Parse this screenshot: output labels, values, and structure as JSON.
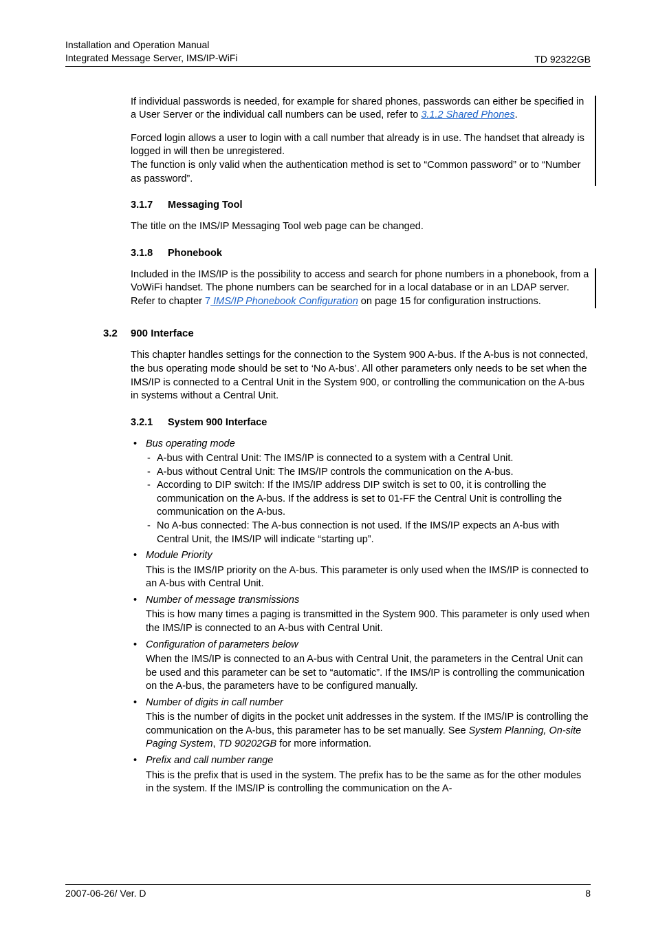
{
  "header": {
    "line1": "Installation and Operation Manual",
    "line2": "Integrated Message Server, IMS/IP-WiFi",
    "doc_id": "TD 92322GB"
  },
  "intro": {
    "p1_pre": "If individual passwords is needed, for example for shared phones, passwords can either be specified in a User Server or the individual call numbers can be used, refer to ",
    "p1_link": "3.1.2 Shared Phones",
    "p2a": "Forced login allows a user to login with a call number that already is in use. The handset that already is logged in will then be unregistered.",
    "p2b": "The function is only valid when the authentication method is set to “Common password” or to “Number as password”."
  },
  "s317": {
    "num": "3.1.7",
    "title": "Messaging Tool",
    "body": "The title on the IMS/IP Messaging Tool web page can be changed."
  },
  "s318": {
    "num": "3.1.8",
    "title": "Phonebook",
    "body_pre": "Included in the IMS/IP is the possibility to access and search for phone numbers in a phonebook, from a VoWiFi handset. The phone numbers can be searched for in a local database or in an LDAP server. Refer to chapter ",
    "body_chnum": "7",
    "body_link": " IMS/IP Phonebook Configuration",
    "body_post": " on page 15 for configuration instructions."
  },
  "s32": {
    "num": "3.2",
    "title": "900 Interface",
    "body": "This chapter handles settings for the connection to the System 900 A-bus. If the A-bus is not connected, the bus operating mode should be set to ‘No A-bus’. All other parameters only needs to be set when the IMS/IP is connected to a Central Unit in the System 900, or controlling the communication on the A-bus in systems without a Central Unit."
  },
  "s321": {
    "num": "3.2.1",
    "title": "System 900 Interface",
    "bullets": [
      {
        "term": "Bus operating mode",
        "dashes": [
          "A-bus with Central Unit: The IMS/IP is connected to a system with a Central Unit.",
          "A-bus without Central Unit: The IMS/IP controls the communication on the A-bus.",
          "According to DIP switch: If the IMS/IP address DIP switch is set to 00, it is controlling the communication on the A-bus. If the address is set to 01-FF the Central Unit is controlling the communication on the A-bus.",
          "No A-bus connected: The A-bus connection is not used. If the IMS/IP expects an A-bus with Central Unit, the IMS/IP will indicate “starting up”."
        ]
      },
      {
        "term": "Module Priority",
        "desc": "This is the IMS/IP priority on the A-bus. This parameter is only used when the IMS/IP is connected to an A-bus with Central Unit."
      },
      {
        "term": "Number of message transmissions",
        "desc": "This is how many times a paging is transmitted in the System 900. This parameter is only used when the IMS/IP is connected to an A-bus with Central Unit."
      },
      {
        "term": "Configuration of parameters below",
        "desc": "When the IMS/IP is connected to an A-bus with Central Unit, the parameters in the Central Unit can be used and this parameter can be set to “automatic”. If the IMS/IP is controlling the communication on the A-bus, the parameters have to be configured manually."
      },
      {
        "term": "Number of digits in call number",
        "desc_pre": "This is the number of digits in the pocket unit addresses in the system. If the IMS/IP is controlling the communication on the A-bus, this parameter has to be set manually. See ",
        "desc_ital1": "System Planning, On-site Paging System",
        "desc_mid": ", ",
        "desc_ital2": "TD 90202GB",
        "desc_post": " for more information."
      },
      {
        "term": "Prefix and call number range",
        "desc": "This is the prefix that is used in the system. The prefix has to be the same as for the other modules in the system. If the IMS/IP is controlling the communication on the A-"
      }
    ]
  },
  "footer": {
    "left": "2007-06-26/ Ver. D",
    "right": "8"
  }
}
